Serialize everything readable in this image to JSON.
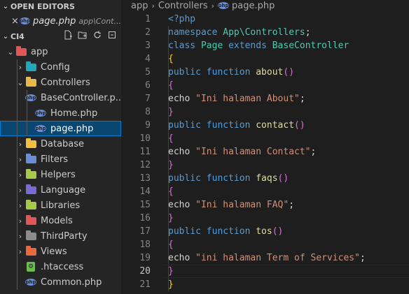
{
  "sidebar": {
    "open_editors_title": "OPEN EDITORS",
    "open_editor": {
      "name": "page.php",
      "description": "app\\Cont..."
    },
    "workspace_title": "CI4",
    "tree": [
      {
        "label": "app",
        "level": 0,
        "chev": "⌄",
        "icon": "folder-app-icon",
        "color": "#e05757"
      },
      {
        "label": "Config",
        "level": 1,
        "chev": "›",
        "icon": "folder-config-icon",
        "color": "#20a8b8"
      },
      {
        "label": "Controllers",
        "level": 1,
        "chev": "⌄",
        "icon": "folder-controllers-icon",
        "color": "#e8b84a"
      },
      {
        "label": "BaseController.p...",
        "level": 2,
        "icon": "php-file-icon"
      },
      {
        "label": "Home.php",
        "level": 2,
        "icon": "php-file-icon"
      },
      {
        "label": "page.php",
        "level": 2,
        "icon": "php-file-icon",
        "selected": true
      },
      {
        "label": "Database",
        "level": 1,
        "chev": "›",
        "icon": "folder-database-icon",
        "color": "#f0c040"
      },
      {
        "label": "Filters",
        "level": 1,
        "chev": "›",
        "icon": "folder-filters-icon",
        "color": "#6a8fd6"
      },
      {
        "label": "Helpers",
        "level": 1,
        "chev": "›",
        "icon": "folder-helpers-icon",
        "color": "#a6c94a"
      },
      {
        "label": "Language",
        "level": 1,
        "chev": "›",
        "icon": "folder-language-icon",
        "color": "#7a6ad6"
      },
      {
        "label": "Libraries",
        "level": 1,
        "chev": "›",
        "icon": "folder-libraries-icon",
        "color": "#a6c94a"
      },
      {
        "label": "Models",
        "level": 1,
        "chev": "›",
        "icon": "folder-models-icon",
        "color": "#e05757"
      },
      {
        "label": "ThirdParty",
        "level": 1,
        "chev": "›",
        "icon": "folder-thirdparty-icon",
        "color": "#8c8c8c"
      },
      {
        "label": "Views",
        "level": 1,
        "chev": "›",
        "icon": "folder-views-icon",
        "color": "#e86a3a"
      },
      {
        "label": ".htaccess",
        "level": 1,
        "icon": "htaccess-file-icon"
      },
      {
        "label": "Common.php",
        "level": 1,
        "icon": "php-file-icon"
      }
    ]
  },
  "breadcrumb": {
    "part1": "app",
    "part2": "Controllers",
    "part3": "page.php"
  },
  "editor": {
    "current_line": 20,
    "lines": [
      [
        [
          "t-tag",
          "<?php"
        ]
      ],
      [
        [
          "t-kw",
          "namespace "
        ],
        [
          "t-ns",
          "App\\Controllers"
        ],
        [
          "t-txt",
          ";"
        ]
      ],
      [
        [
          "t-kw",
          "class "
        ],
        [
          "t-cls",
          "Page "
        ],
        [
          "t-kw",
          "extends "
        ],
        [
          "t-cls",
          "BaseController"
        ]
      ],
      [
        [
          "t-b1",
          "{"
        ]
      ],
      [
        [
          "t-kw",
          "public function "
        ],
        [
          "t-fn",
          "about"
        ],
        [
          "t-b2",
          "()"
        ]
      ],
      [
        [
          "t-b2",
          "{"
        ]
      ],
      [
        [
          "t-txt",
          "echo "
        ],
        [
          "t-str",
          "\"Ini halaman About\""
        ],
        [
          "t-txt",
          ";"
        ]
      ],
      [
        [
          "t-b2",
          "}"
        ]
      ],
      [
        [
          "t-kw",
          "public function "
        ],
        [
          "t-fn",
          "contact"
        ],
        [
          "t-b2",
          "()"
        ]
      ],
      [
        [
          "t-b2",
          "{"
        ]
      ],
      [
        [
          "t-txt",
          "echo "
        ],
        [
          "t-str",
          "\"Ini halaman Contact\""
        ],
        [
          "t-txt",
          ";"
        ]
      ],
      [
        [
          "t-b2",
          "}"
        ]
      ],
      [
        [
          "t-kw",
          "public function "
        ],
        [
          "t-fn",
          "faqs"
        ],
        [
          "t-b2",
          "()"
        ]
      ],
      [
        [
          "t-b2",
          "{"
        ]
      ],
      [
        [
          "t-txt",
          "echo "
        ],
        [
          "t-str",
          "\"Ini halaman FAQ\""
        ],
        [
          "t-txt",
          ";"
        ]
      ],
      [
        [
          "t-b2",
          "}"
        ]
      ],
      [
        [
          "t-kw",
          "public function "
        ],
        [
          "t-fn",
          "tos"
        ],
        [
          "t-b2",
          "()"
        ]
      ],
      [
        [
          "t-b2",
          "{"
        ]
      ],
      [
        [
          "t-txt",
          "echo "
        ],
        [
          "t-str",
          "\"ini halaman Term of Services\""
        ],
        [
          "t-txt",
          ";"
        ]
      ],
      [
        [
          "t-b2",
          "}"
        ]
      ],
      [
        [
          "t-b1",
          "}"
        ]
      ]
    ]
  },
  "icons": {
    "close": "×",
    "new_file": "new-file-icon",
    "new_folder": "new-folder-icon",
    "refresh": "refresh-icon",
    "collapse": "collapse-all-icon"
  }
}
